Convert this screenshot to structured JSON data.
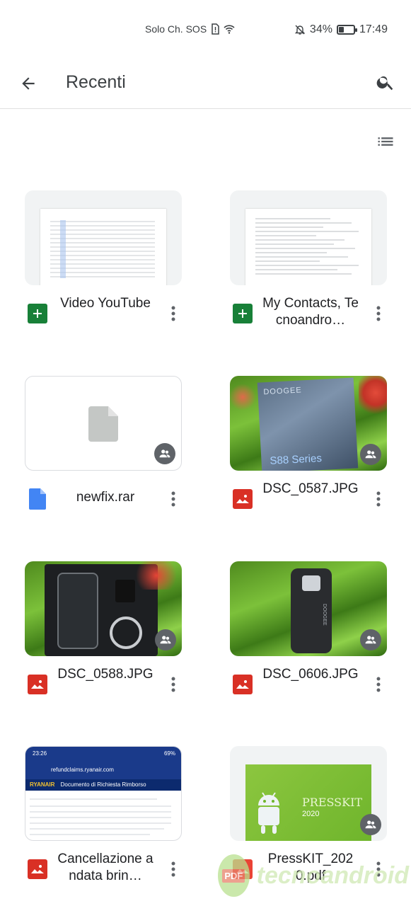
{
  "status_bar": {
    "carrier": "Solo Ch. SOS",
    "battery_percent": "34%",
    "battery_level": 0.34,
    "time": "17:49"
  },
  "app_bar": {
    "title": "Recenti"
  },
  "files": [
    {
      "name": "Video YouTube",
      "type": "sheets",
      "shared": false,
      "thumb": "spreadsheet"
    },
    {
      "name": "My Contacts, Tecnoandro…",
      "type": "sheets",
      "shared": false,
      "thumb": "spreadsheet"
    },
    {
      "name": "newfix.rar",
      "type": "file",
      "shared": true,
      "thumb": "generic"
    },
    {
      "name": "DSC_0587.JPG",
      "type": "image",
      "shared": true,
      "thumb": "photo-box"
    },
    {
      "name": "DSC_0588.JPG",
      "type": "image",
      "shared": true,
      "thumb": "photo-unbox"
    },
    {
      "name": "DSC_0606.JPG",
      "type": "image",
      "shared": true,
      "thumb": "photo-phone"
    },
    {
      "name": "Cancellazione andata brin…",
      "type": "image",
      "shared": false,
      "thumb": "screenshot"
    },
    {
      "name": "PressKIT_2020.pdf",
      "type": "pdf",
      "shared": true,
      "thumb": "presskit"
    }
  ],
  "thumbs": {
    "photo_box_brand": "DOOGEE",
    "photo_box_series": "S88 Series",
    "photo_phone_brand": "DOOGEE",
    "screenshot_time": "23:26",
    "screenshot_battery": "69%",
    "screenshot_url": "refundclaims.ryanair.com",
    "screenshot_brand": "RYANAIR",
    "screenshot_heading": "Documento di Richiesta Rimborso",
    "presskit_label": "PRESSKIT",
    "presskit_year": "2020"
  },
  "watermark": {
    "badge": "PDF",
    "text": "tecnoandroid"
  },
  "colors": {
    "sheets_green": "#188038",
    "docs_blue": "#4285f4",
    "image_red": "#d93025",
    "pdf_red": "#ea4335",
    "icon_grey": "#5f6368"
  }
}
